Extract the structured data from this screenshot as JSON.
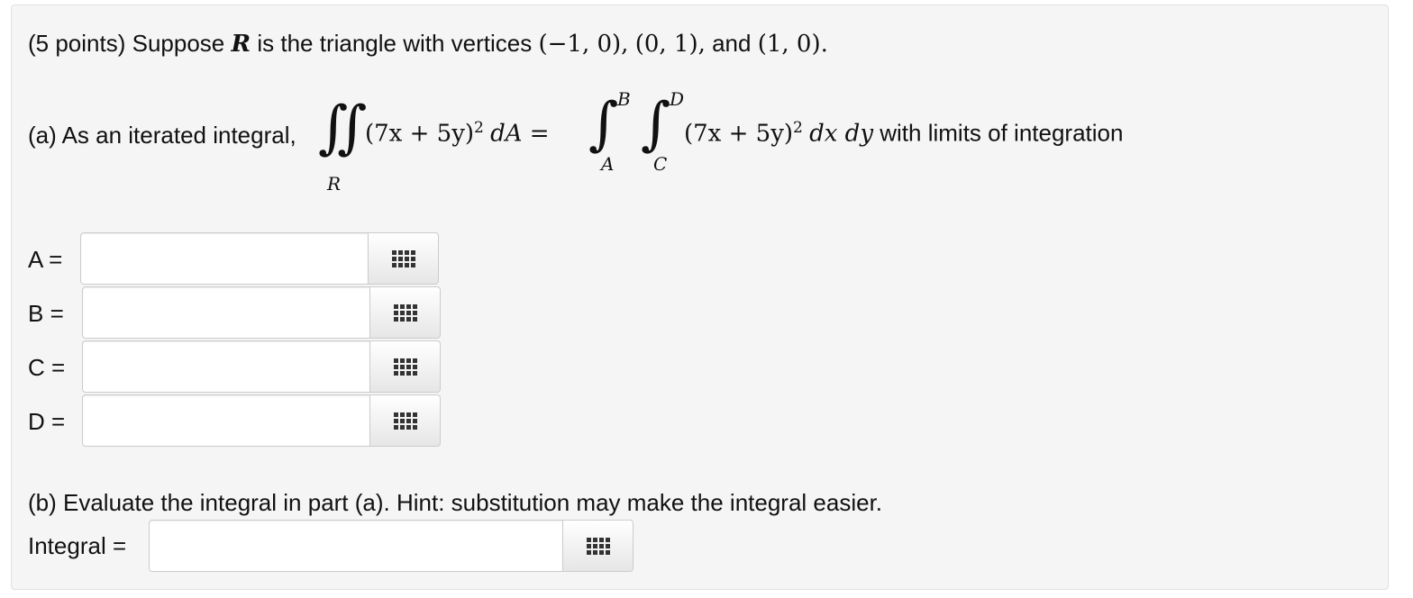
{
  "problem": {
    "points": "(5 points)",
    "intro": "Suppose",
    "region_var": "R",
    "intro_mid": "is the triangle with vertices",
    "v1": "(−1, 0),",
    "v2": "(0, 1),",
    "and": "and",
    "v3": "(1, 0)."
  },
  "part_a": {
    "label": "(a) As an iterated integral,",
    "integrand": "(7x + 5y)",
    "exponent": "2",
    "dA": "dA =",
    "region_sub": "R",
    "outer_upper": "B",
    "outer_lower": "A",
    "inner_upper": "D",
    "inner_lower": "C",
    "differentials": "dx dy",
    "tail": "with limits of integration"
  },
  "answers": [
    {
      "label": "A =",
      "value": ""
    },
    {
      "label": "B =",
      "value": ""
    },
    {
      "label": "C =",
      "value": ""
    },
    {
      "label": "D =",
      "value": ""
    }
  ],
  "part_b": {
    "label": "(b) Evaluate the integral in part (a). Hint: substitution may make the integral easier.",
    "integral_label": "Integral =",
    "integral_value": ""
  },
  "icons": {
    "equation_editor": "grid-icon"
  }
}
